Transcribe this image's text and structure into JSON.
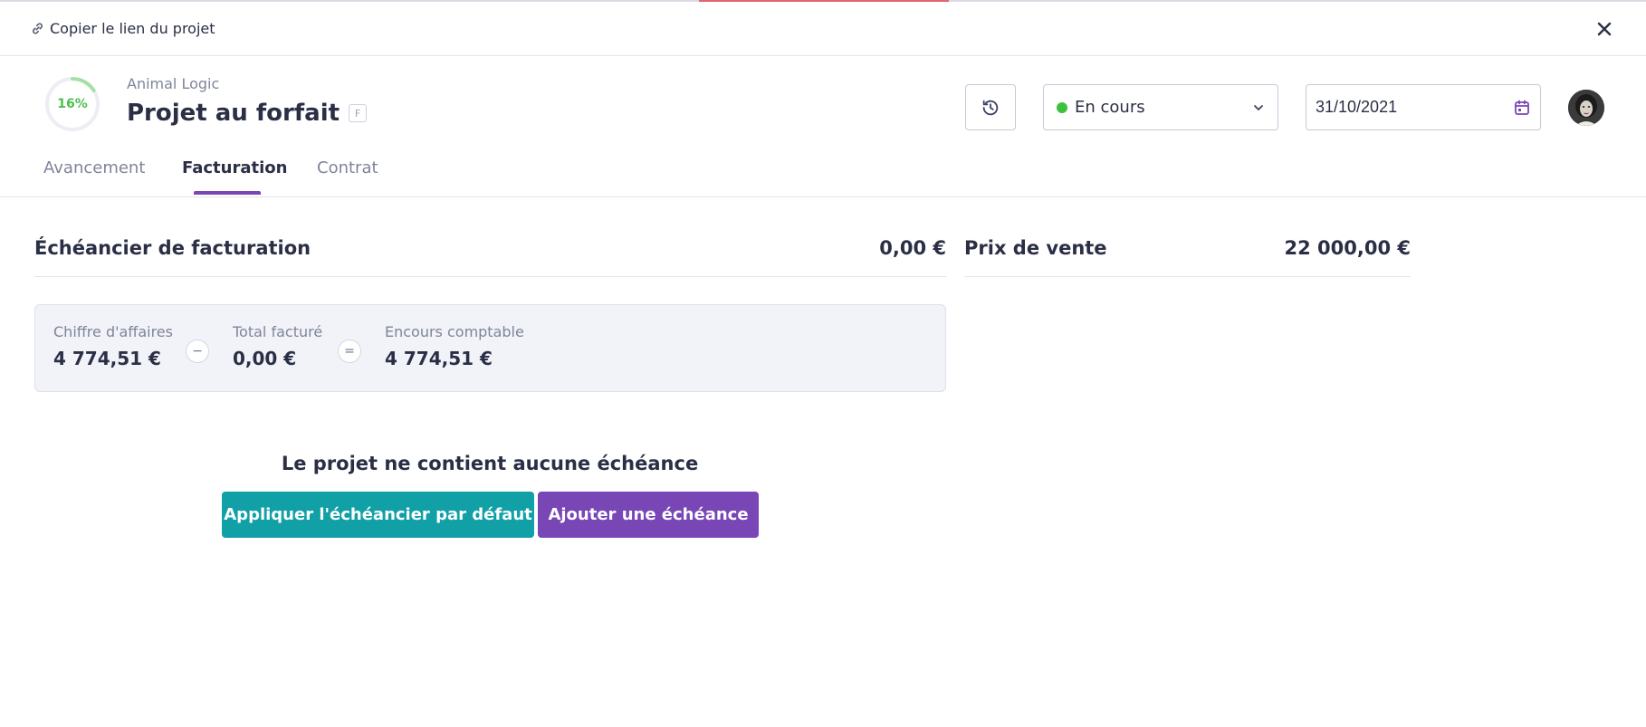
{
  "topbar": {
    "copy_link_label": "Copier le lien du projet",
    "link_icon": "link-icon",
    "close_icon": "close-icon"
  },
  "project": {
    "progress": "16%",
    "progress_fraction": 0.16,
    "progress_color": "#4cbf4c",
    "client": "Animal Logic",
    "title": "Projet au forfait",
    "type_badge": "F"
  },
  "actions": {
    "history_icon": "history-icon",
    "status": {
      "label": "En cours",
      "dot_color": "#3cc13c"
    },
    "date": "31/10/2021",
    "calendar_icon": "calendar-icon"
  },
  "tabs": [
    {
      "label": "Avancement",
      "active": false
    },
    {
      "label": "Facturation",
      "active": true
    },
    {
      "label": "Contrat",
      "active": false
    }
  ],
  "billing": {
    "schedule_title": "Échéancier de facturation",
    "schedule_value": "0,00 €",
    "sale_price_title": "Prix de vente",
    "sale_price_value": "22 000,00 €"
  },
  "summary": {
    "revenue": {
      "label": "Chiffre d'affaires",
      "value": "4 774,51 €"
    },
    "minus_sign": "−",
    "invoiced": {
      "label": "Total facturé",
      "value": "0,00 €"
    },
    "equals_sign": "=",
    "outstanding": {
      "label": "Encours comptable",
      "value": "4 774,51 €"
    }
  },
  "empty_state": {
    "message": "Le projet ne contient aucune échéance",
    "apply_default_button": "Appliquer l'échéancier par défaut",
    "add_button": "Ajouter une échéance"
  },
  "colors": {
    "accent_purple": "#7846b5",
    "accent_teal": "#12a0a7",
    "text_primary": "#2b2f45",
    "text_muted": "#7f849a"
  }
}
